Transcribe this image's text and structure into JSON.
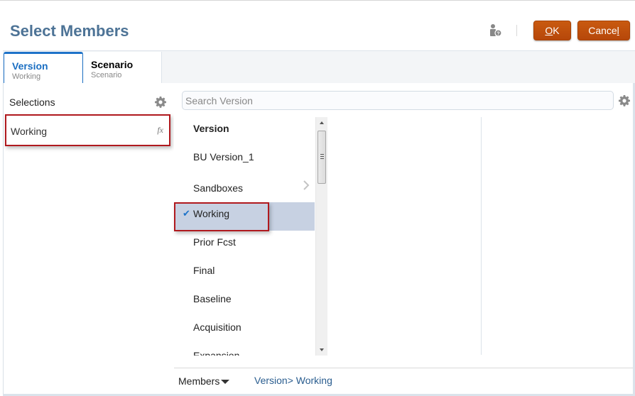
{
  "dialog": {
    "title": "Select Members",
    "ok_label": "OK",
    "ok_accesskey": "O",
    "ok_rest": "K",
    "cancel_label": "Cancel",
    "cancel_prefix": "Cance",
    "cancel_accesskey": "l"
  },
  "tabs": [
    {
      "label": "Version",
      "sub": "Working",
      "active": true
    },
    {
      "label": "Scenario",
      "sub": "Scenario",
      "active": false
    }
  ],
  "selections": {
    "label": "Selections",
    "items": [
      {
        "label": "Working",
        "icon": "fx"
      }
    ]
  },
  "search": {
    "placeholder": "Search Version",
    "value": ""
  },
  "members": {
    "items": [
      {
        "label": "Version",
        "header": true
      },
      {
        "label": "BU Version_1"
      },
      {
        "label": "Sandboxes",
        "has_children": true
      },
      {
        "label": "Working",
        "selected": true
      },
      {
        "label": "Prior Fcst"
      },
      {
        "label": "Final"
      },
      {
        "label": "Baseline"
      },
      {
        "label": "Acquisition"
      },
      {
        "label": "Expansion"
      }
    ]
  },
  "footer": {
    "members_label": "Members",
    "breadcrumb": [
      "Version>",
      "Working"
    ]
  },
  "colors": {
    "title": "#4d7396",
    "button": "#c0510e",
    "active_tab": "#1e73c9",
    "selected_row": "#c7d1e2",
    "annotation": "#b0191e"
  }
}
